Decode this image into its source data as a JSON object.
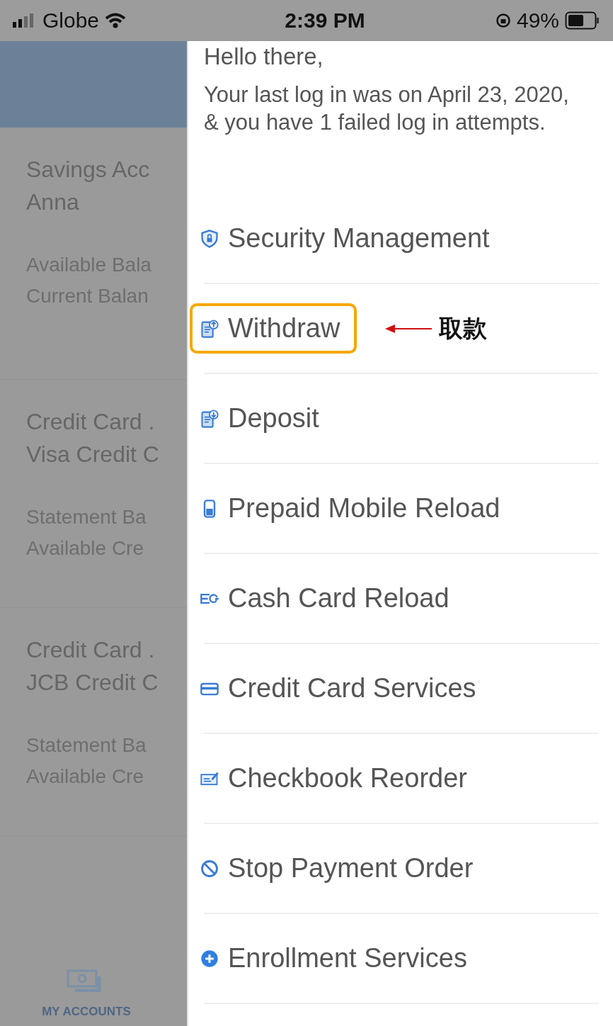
{
  "status_bar": {
    "carrier": "Globe",
    "time": "2:39 PM",
    "battery": "49%"
  },
  "background": {
    "accounts": [
      {
        "title": "Savings Acc",
        "subtitle": "Anna",
        "lines": [
          "Available Bala",
          "Current Balan"
        ]
      },
      {
        "title": "Credit Card .",
        "subtitle": "Visa Credit C",
        "lines": [
          "Statement Ba",
          "Available Cre"
        ]
      },
      {
        "title": "Credit Card .",
        "subtitle": "JCB Credit C",
        "lines": [
          "Statement Ba",
          "Available Cre"
        ]
      }
    ],
    "tab": {
      "label": "MY ACCOUNTS"
    }
  },
  "drawer": {
    "greeting": "Hello there,",
    "last_login": "Your last log in was on April 23, 2020, & you have 1 failed log in attempts.",
    "items": [
      {
        "label": "Security Management",
        "kind": "shield",
        "highlighted": false
      },
      {
        "label": "Withdraw",
        "kind": "withdraw",
        "highlighted": true
      },
      {
        "label": "Deposit",
        "kind": "deposit",
        "highlighted": false
      },
      {
        "label": "Prepaid Mobile Reload",
        "kind": "phone",
        "highlighted": false
      },
      {
        "label": "Cash Card Reload",
        "kind": "cashcard",
        "highlighted": false
      },
      {
        "label": "Credit Card Services",
        "kind": "card",
        "highlighted": false
      },
      {
        "label": "Checkbook Reorder",
        "kind": "check",
        "highlighted": false
      },
      {
        "label": "Stop Payment Order",
        "kind": "stop",
        "highlighted": false
      },
      {
        "label": "Enrollment Services",
        "kind": "plus",
        "highlighted": false
      }
    ]
  },
  "annotation": {
    "text": "取款"
  }
}
